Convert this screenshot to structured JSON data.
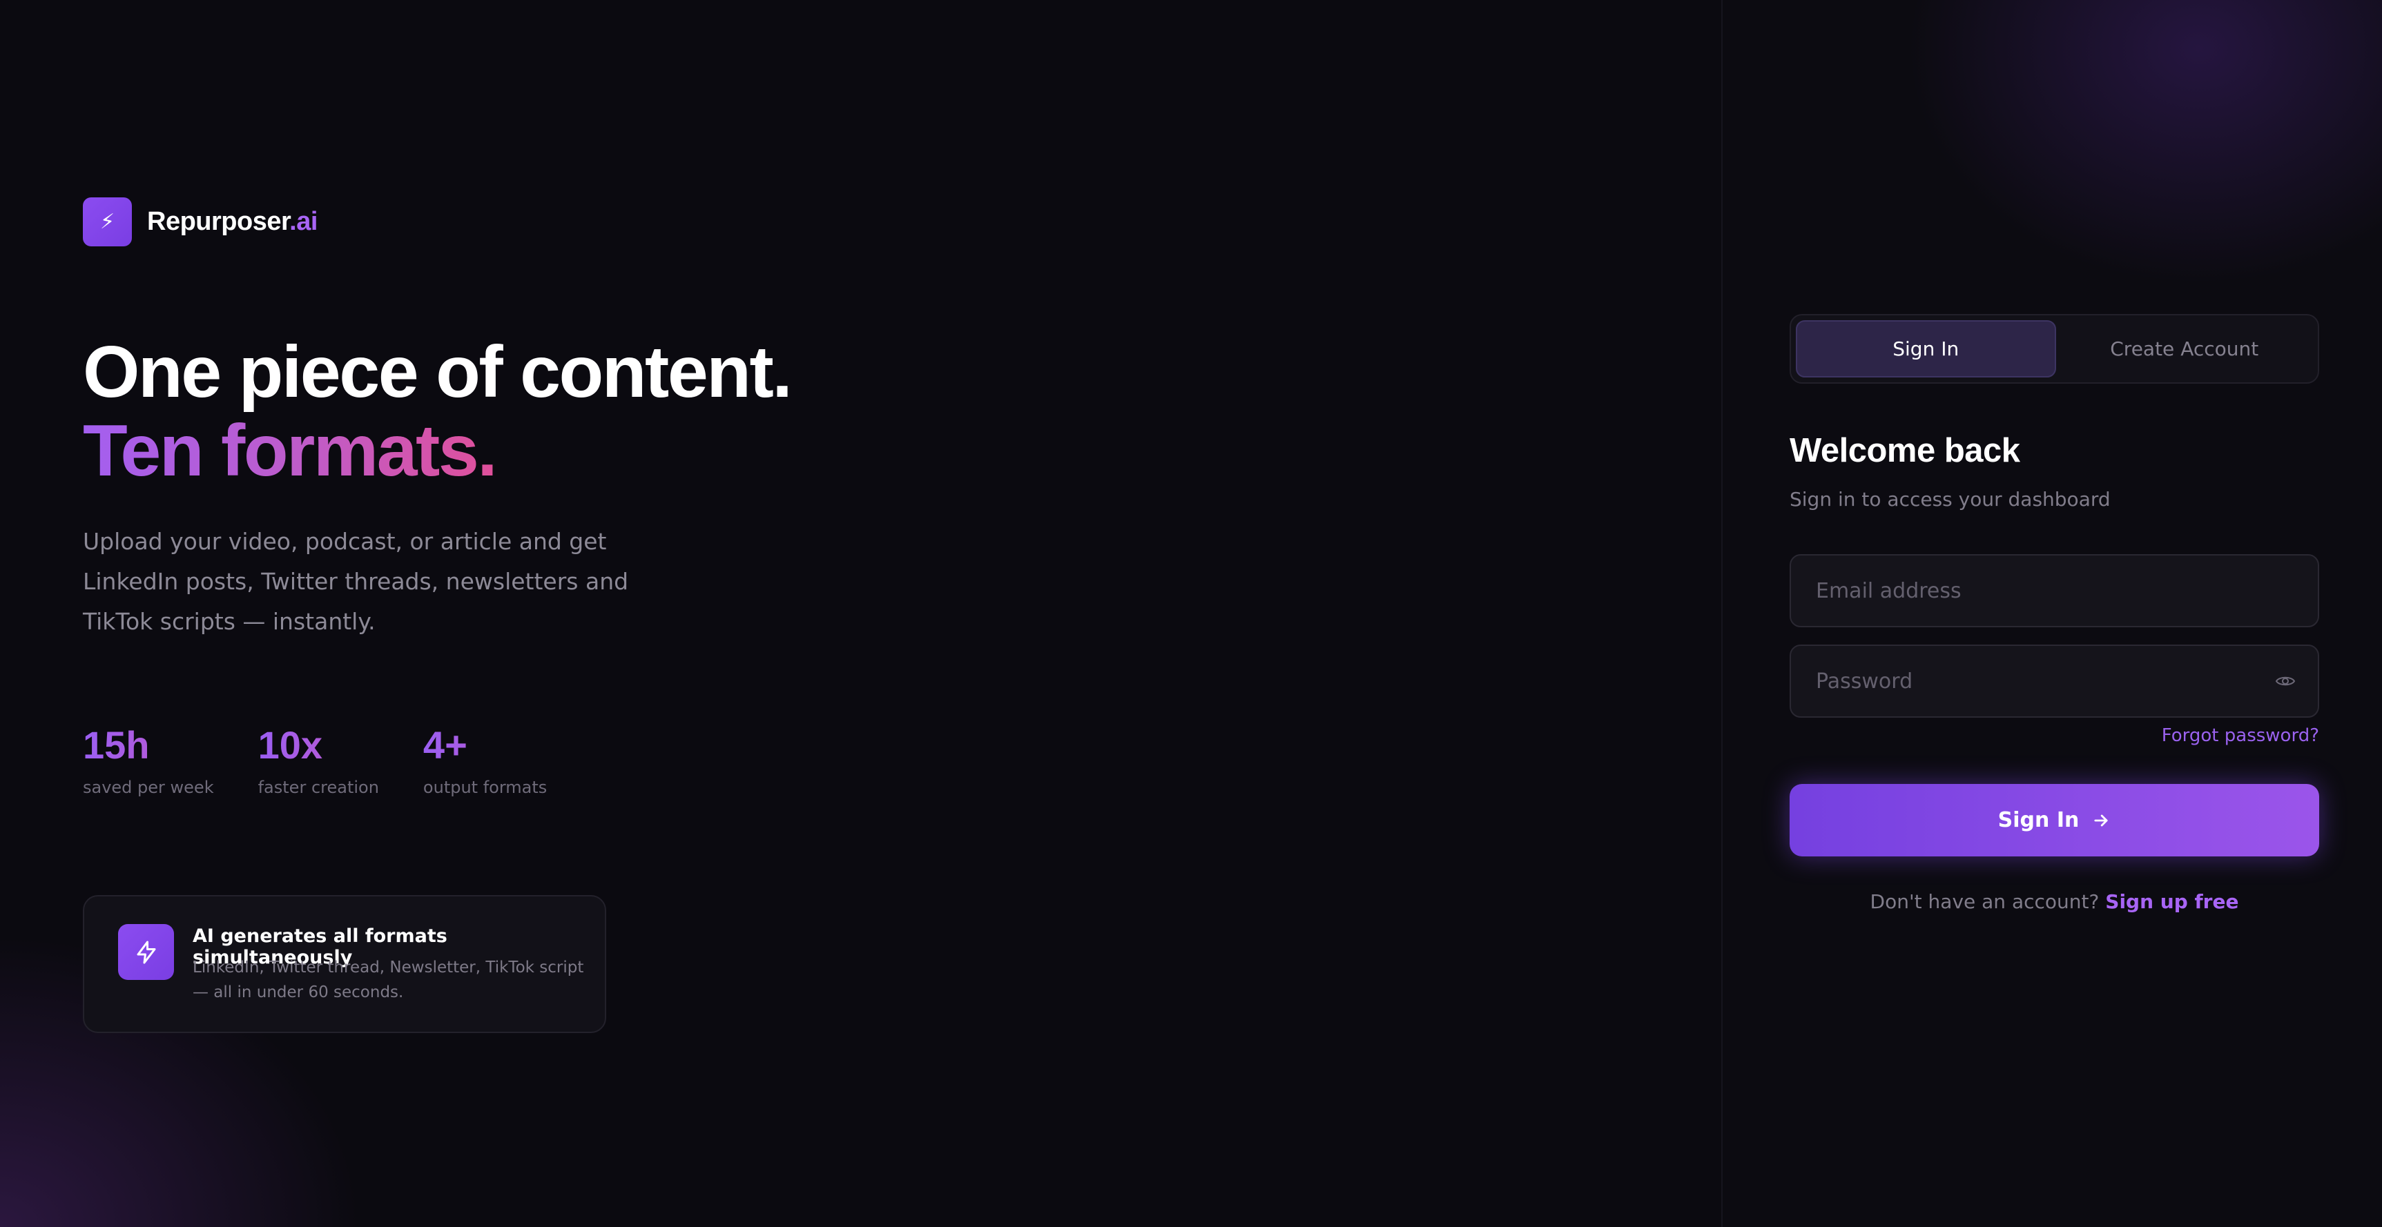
{
  "brand": {
    "logo_glyph": "⚡",
    "name_main": "Repurposer",
    "name_accent": ".ai",
    "accent_color": "#a865f5"
  },
  "hero": {
    "headline_line1": "One piece of content.",
    "headline_line2": "Ten formats.",
    "subtext": "Upload your video, podcast, or article and get LinkedIn posts, Twitter threads, newsletters and TikTok scripts — instantly."
  },
  "stats": [
    {
      "value": "15h",
      "label": "saved per week"
    },
    {
      "value": "10x",
      "label": "faster creation"
    },
    {
      "value": "4+",
      "label": "output formats"
    }
  ],
  "feature": {
    "icon": "lightning-icon",
    "title": "AI generates all formats simultaneously",
    "description": "LinkedIn, Twitter thread, Newsletter, TikTok script — all in under 60 seconds."
  },
  "auth": {
    "tabs": [
      {
        "label": "Sign In",
        "active": true
      },
      {
        "label": "Create Account",
        "active": false
      }
    ],
    "heading": "Welcome back",
    "subheading": "Sign in to access your dashboard",
    "email_placeholder": "Email address",
    "password_placeholder": "Password",
    "forgot_label": "Forgot password?",
    "submit_label": "Sign In",
    "signup_prompt": "Don't have an account?",
    "signup_link": "Sign up free"
  },
  "colors": {
    "background": "#0b0a10",
    "primary": "#7c45e4",
    "muted_text": "#817d8b"
  }
}
